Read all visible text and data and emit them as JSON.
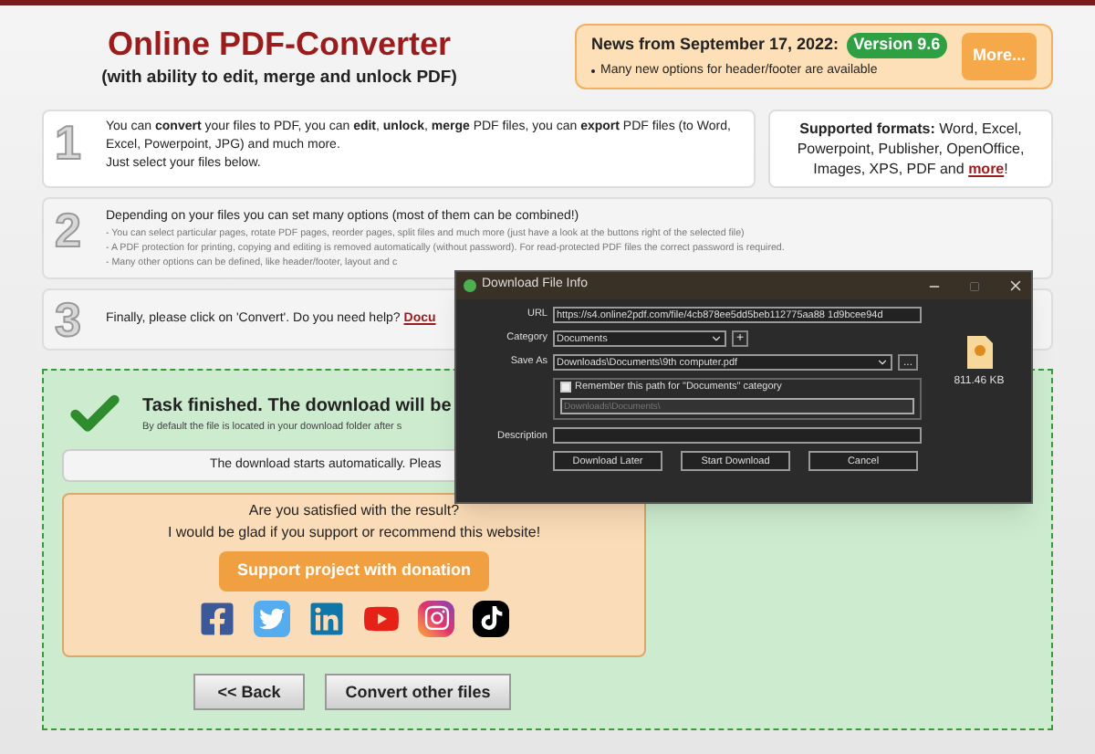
{
  "header": {
    "title": "Online PDF-Converter",
    "subtitle": "(with ability to edit, merge and unlock PDF)"
  },
  "news": {
    "heading": "News from September 17, 2022:",
    "version": "Version 9.6",
    "items": [
      "Many new options for header/footer are available"
    ],
    "more_button": "More..."
  },
  "steps": [
    {
      "number": "1",
      "lines": [
        "You can **convert** your files to PDF, you can **edit**, **unlock**, **merge** PDF files, you can **export** PDF files (to Word, Excel, Powerpoint, JPG) and much more.",
        "Just select your files below."
      ]
    },
    {
      "number": "2",
      "lines": [
        "Depending on your files you can set many options (most of them can be combined!)"
      ],
      "notes": [
        "- You can select particular pages, rotate PDF pages, reorder pages, split files and much more (just have a look at the buttons right of the selected file)",
        "- A PDF protection for printing, copying and editing is removed automatically (without password). For read-protected PDF files the correct password is required.",
        "- Many other options can be defined, like header/footer, layout and c"
      ]
    },
    {
      "number": "3",
      "lines": [
        "Finally, please click on 'Convert'. Do you need help?"
      ],
      "link": "Docu"
    }
  ],
  "formats": {
    "text": "**Supported formats:** Word, Excel, Powerpoint, Publisher, OpenOffice, Images, XPS, PDF and",
    "link": "more",
    "suffix": "!"
  },
  "result": {
    "title": "Task finished. The download will be",
    "note": "By default the file is located in your download folder after s",
    "download_message": "The download starts automatically. Pleas",
    "support": {
      "question": "Are you satisfied with the result?",
      "plea": "I would be glad if you support or recommend this website!",
      "donate_button": "Support project with donation",
      "social": [
        {
          "kind": "facebook"
        },
        {
          "kind": "twitter"
        },
        {
          "kind": "linkedin"
        },
        {
          "kind": "youtube"
        },
        {
          "kind": "instagram"
        },
        {
          "kind": "tiktok"
        }
      ]
    },
    "buttons": [
      "<< Back",
      "Convert other files"
    ]
  },
  "dialog": {
    "title": "Download File Info",
    "url_label": "URL",
    "url": "https://s4.online2pdf.com/file/4cb878ee5dd5beb112775aa88 1d9bcee94d",
    "category_label": "Category",
    "category": "Documents",
    "save_as_label": "Save As",
    "save_as": "Downloads\\Documents\\9th computer.pdf",
    "browse_button": "...",
    "add_button": "+",
    "remember": {
      "label": "Remember this path for \"Documents\" category",
      "checked": false
    },
    "path_placeholder": "Downloads\\Documents\\",
    "description_label": "Description",
    "file_size": "811.46 KB",
    "buttons": [
      "Download Later",
      "Start Download",
      "Cancel"
    ]
  }
}
